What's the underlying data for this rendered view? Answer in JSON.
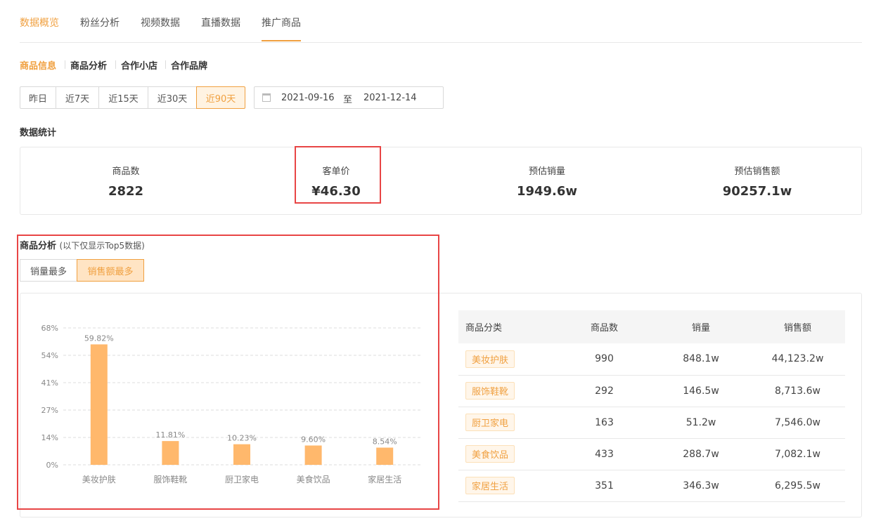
{
  "tabs": [
    {
      "label": "数据概览",
      "active": true
    },
    {
      "label": "粉丝分析",
      "active": false
    },
    {
      "label": "视频数据",
      "active": false
    },
    {
      "label": "直播数据",
      "active": false
    },
    {
      "label": "推广商品",
      "active": false
    }
  ],
  "subnav": [
    {
      "label": "商品信息",
      "active": true
    },
    {
      "label": "商品分析",
      "active": false
    },
    {
      "label": "合作小店",
      "active": false
    },
    {
      "label": "合作品牌",
      "active": false
    }
  ],
  "ranges": [
    {
      "label": "昨日",
      "active": false
    },
    {
      "label": "近7天",
      "active": false
    },
    {
      "label": "近15天",
      "active": false
    },
    {
      "label": "近30天",
      "active": false
    },
    {
      "label": "近90天",
      "active": true
    }
  ],
  "date_range": {
    "start": "2021-09-16",
    "separator": "至",
    "end": "2021-12-14"
  },
  "stats_title": "数据统计",
  "stats": [
    {
      "label": "商品数",
      "value": "2822"
    },
    {
      "label": "客单价",
      "value": "¥46.30"
    },
    {
      "label": "预估销量",
      "value": "1949.6w"
    },
    {
      "label": "预估销售额",
      "value": "90257.1w"
    }
  ],
  "analysis": {
    "title": "商品分析",
    "note": "(以下仅显示Top5数据)",
    "sort_options": [
      {
        "label": "销量最多",
        "active": false
      },
      {
        "label": "销售额最多",
        "active": true
      }
    ]
  },
  "colors": {
    "accent": "#f0a040",
    "bar": "#ffb86c",
    "highlight": "#e84545"
  },
  "chart_data": {
    "type": "bar",
    "categories": [
      "美妆护肤",
      "服饰鞋靴",
      "厨卫家电",
      "美食饮品",
      "家居生活"
    ],
    "values": [
      59.82,
      11.81,
      10.23,
      9.6,
      8.54
    ],
    "data_labels": [
      "59.82%",
      "11.81%",
      "10.23%",
      "9.60%",
      "8.54%"
    ],
    "y_ticks": [
      "0%",
      "14%",
      "27%",
      "41%",
      "54%",
      "68%"
    ],
    "ylim": [
      0,
      68
    ],
    "grid": true
  },
  "table": {
    "headers": [
      "商品分类",
      "商品数",
      "销量",
      "销售额"
    ],
    "rows": [
      [
        "美妆护肤",
        "990",
        "848.1w",
        "44,123.2w"
      ],
      [
        "服饰鞋靴",
        "292",
        "146.5w",
        "8,713.6w"
      ],
      [
        "厨卫家电",
        "163",
        "51.2w",
        "7,546.0w"
      ],
      [
        "美食饮品",
        "433",
        "288.7w",
        "7,082.1w"
      ],
      [
        "家居生活",
        "351",
        "346.3w",
        "6,295.5w"
      ]
    ]
  }
}
